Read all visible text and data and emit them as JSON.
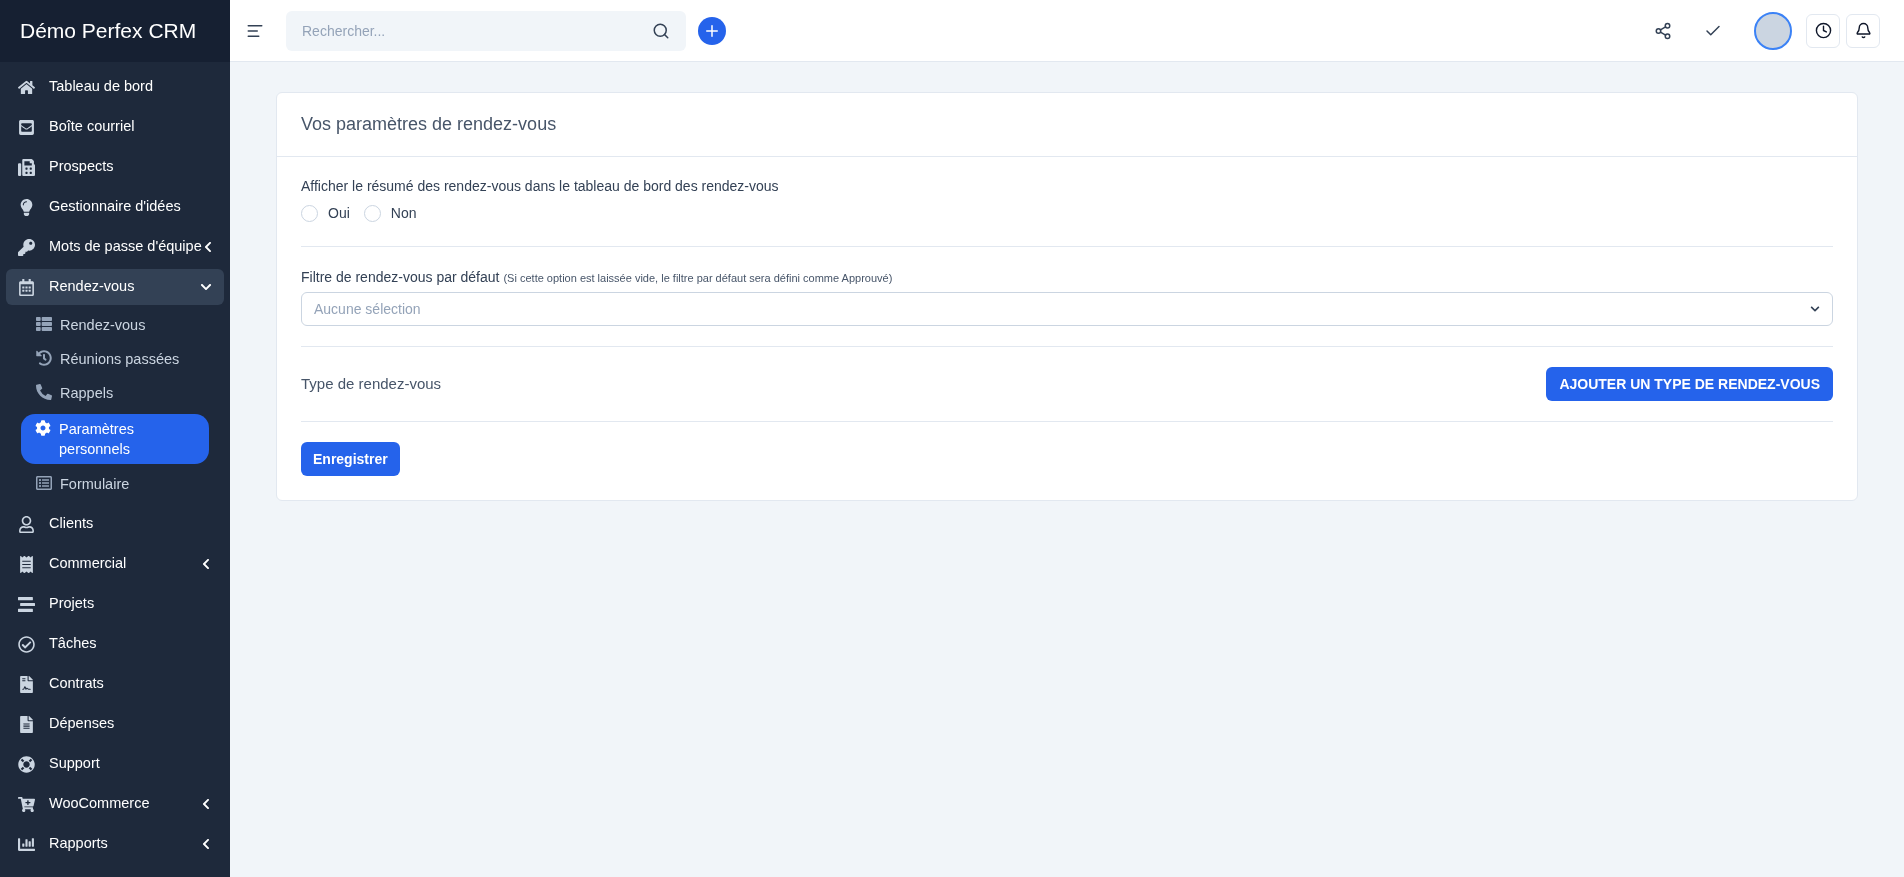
{
  "app": {
    "title": "Démo Perfex CRM"
  },
  "sidebar": {
    "items": [
      {
        "label": "Tableau de bord",
        "kind": "link"
      },
      {
        "label": "Boîte courriel",
        "kind": "link"
      },
      {
        "label": "Prospects",
        "kind": "link"
      },
      {
        "label": "Gestionnaire d'idées",
        "kind": "link"
      },
      {
        "label": "Mots de passe d'équipe",
        "kind": "group",
        "expanded": false
      },
      {
        "label": "Rendez-vous",
        "kind": "group",
        "expanded": true,
        "children": [
          {
            "label": "Rendez-vous",
            "selected": false
          },
          {
            "label": "Réunions passées",
            "selected": false
          },
          {
            "label": "Rappels",
            "selected": false
          },
          {
            "label": "Paramètres personnels",
            "selected": true
          },
          {
            "label": "Formulaire",
            "selected": false
          }
        ]
      },
      {
        "label": "Clients",
        "kind": "link"
      },
      {
        "label": "Commercial",
        "kind": "group",
        "expanded": false
      },
      {
        "label": "Projets",
        "kind": "link"
      },
      {
        "label": "Tâches",
        "kind": "link"
      },
      {
        "label": "Contrats",
        "kind": "link"
      },
      {
        "label": "Dépenses",
        "kind": "link"
      },
      {
        "label": "Support",
        "kind": "link"
      },
      {
        "label": "WooCommerce",
        "kind": "group",
        "expanded": false
      },
      {
        "label": "Rapports",
        "kind": "group",
        "expanded": false
      }
    ]
  },
  "topbar": {
    "search": {
      "placeholder": "Rechercher..."
    }
  },
  "card": {
    "title": "Vos paramètres de rendez-vous",
    "summary": {
      "label": "Afficher le résumé des rendez-vous dans le tableau de bord des rendez-vous",
      "options": [
        {
          "label": "Oui",
          "selected": false
        },
        {
          "label": "Non",
          "selected": false
        }
      ]
    },
    "filter": {
      "label": "Filtre de rendez-vous par défaut",
      "hint": "(Si cette option est laissée vide, le filtre par défaut sera défini comme Approuvé)",
      "placeholder": "Aucune sélection"
    },
    "types": {
      "label": "Type de rendez-vous",
      "button": "AJOUTER UN TYPE DE RENDEZ-VOUS"
    },
    "save": "Enregistrer"
  }
}
